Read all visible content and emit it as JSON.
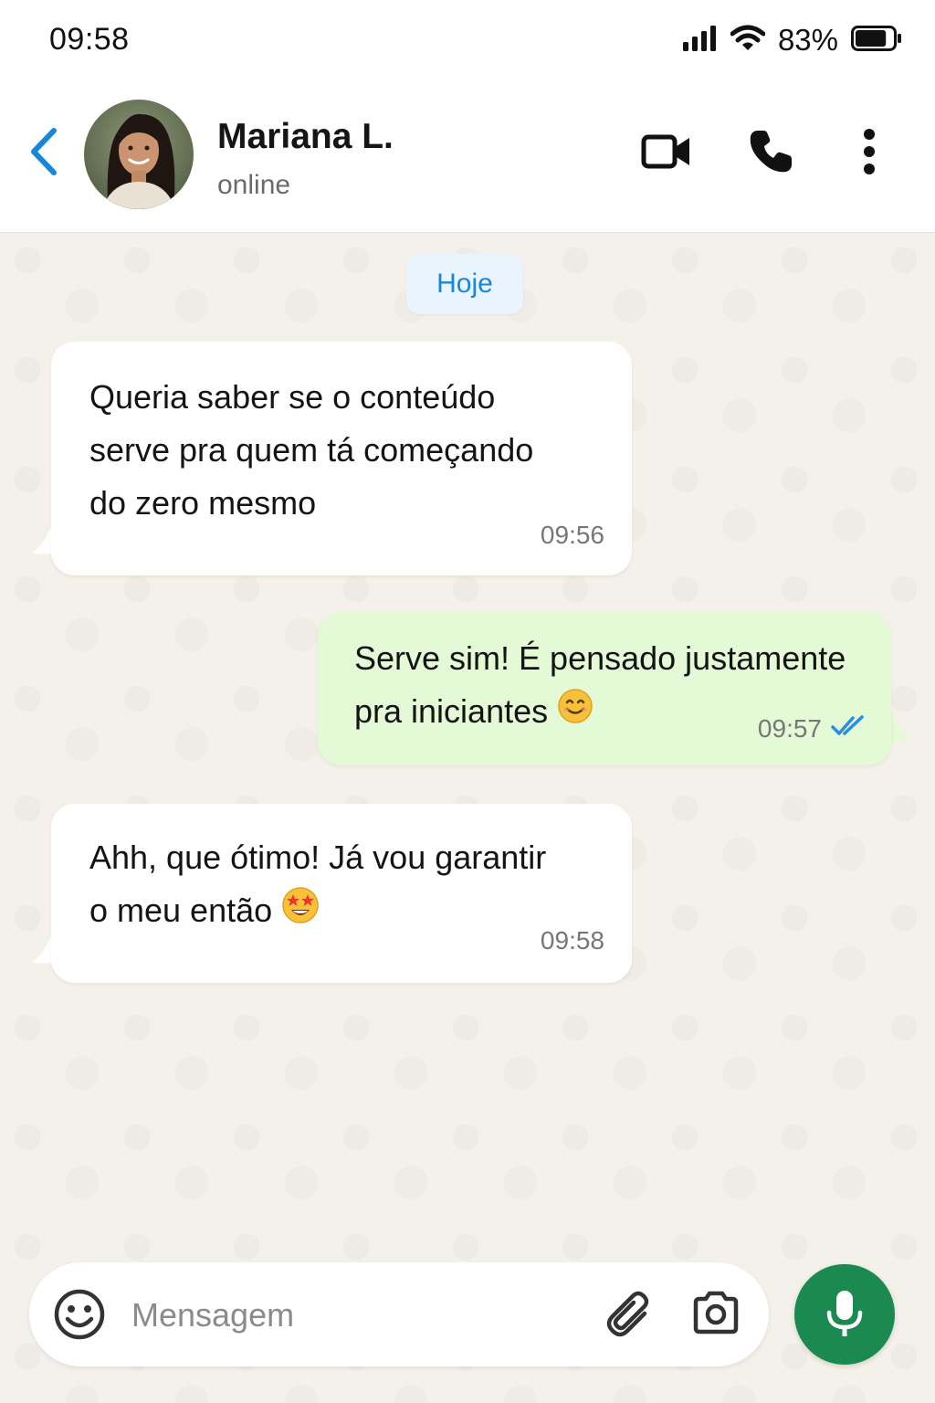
{
  "status_bar": {
    "time": "09:58",
    "battery_percent": "83%",
    "battery_level": 0.83,
    "icons": [
      "signal-icon",
      "wifi-icon",
      "battery-icon"
    ]
  },
  "header": {
    "back_icon": "chevron-left-icon",
    "contact_name": "Mariana L.",
    "contact_status": "online",
    "actions": [
      "video-call-icon",
      "phone-icon",
      "more-vertical-icon"
    ],
    "accent_color": "#1a86d8"
  },
  "chat": {
    "date_label": "Hoje",
    "messages": [
      {
        "direction": "incoming",
        "text": "Queria saber se o conteúdo\nserve pra quem tá começando\ndo zero mesmo",
        "time": "09:56"
      },
      {
        "direction": "outgoing",
        "text": "Serve sim! É pensado justamente\npra iniciantes",
        "emoji": "smiling-face-icon",
        "time": "09:57",
        "read_receipt": "double-check-icon",
        "receipt_color": "#2b8de0"
      },
      {
        "direction": "incoming",
        "text": "Ahh, que ótimo! Já vou garantir\no meu então",
        "emoji": "star-struck-icon",
        "time": "09:58"
      }
    ]
  },
  "composer": {
    "placeholder": "Mensagem",
    "value": "",
    "icons": [
      "emoji-icon",
      "paperclip-icon",
      "camera-icon"
    ],
    "send_button_icon": "microphone-icon",
    "send_button_color": "#1a8a50"
  }
}
